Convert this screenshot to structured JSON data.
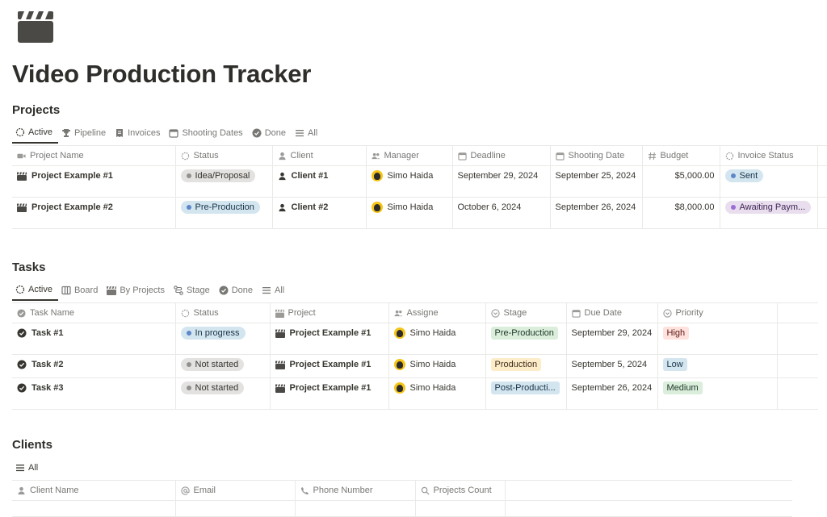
{
  "page": {
    "title": "Video Production Tracker",
    "icon": "clapperboard-icon"
  },
  "projects": {
    "title": "Projects",
    "views": [
      {
        "label": "Active",
        "icon": "loading-icon"
      },
      {
        "label": "Pipeline",
        "icon": "trophy-icon"
      },
      {
        "label": "Invoices",
        "icon": "receipt-icon"
      },
      {
        "label": "Shooting Dates",
        "icon": "calendar-icon"
      },
      {
        "label": "Done",
        "icon": "check-circle-icon"
      },
      {
        "label": "All",
        "icon": "list-icon"
      }
    ],
    "columns": [
      "Project Name",
      "Status",
      "Client",
      "Manager",
      "Deadline",
      "Shooting Date",
      "Budget",
      "Invoice Status"
    ],
    "rows": [
      {
        "name": "Project Example #1",
        "status": "Idea/Proposal",
        "client": "Client #1",
        "manager": "Simo Haida",
        "deadline": "September 29, 2024",
        "shooting": "September 25, 2024",
        "budget": "$5,000.00",
        "invoice": "Sent"
      },
      {
        "name": "Project Example #2",
        "status": "Pre-Production",
        "client": "Client #2",
        "manager": "Simo Haida",
        "deadline": "October 6, 2024",
        "shooting": "September 26, 2024",
        "budget": "$8,000.00",
        "invoice": "Awaiting Paym..."
      }
    ]
  },
  "tasks": {
    "title": "Tasks",
    "views": [
      {
        "label": "Active",
        "icon": "loading-icon"
      },
      {
        "label": "Board",
        "icon": "board-icon"
      },
      {
        "label": "By Projects",
        "icon": "clapperboard-icon"
      },
      {
        "label": "Stage",
        "icon": "flow-icon"
      },
      {
        "label": "Done",
        "icon": "check-circle-icon"
      },
      {
        "label": "All",
        "icon": "list-icon"
      }
    ],
    "columns": [
      "Task Name",
      "Status",
      "Project",
      "Assigne",
      "Stage",
      "Due Date",
      "Priority"
    ],
    "rows": [
      {
        "name": "Task #1",
        "status": "In progress",
        "project": "Project Example #1",
        "assignee": "Simo Haida",
        "stage": "Pre-Production",
        "due": "September 29, 2024",
        "priority": "High"
      },
      {
        "name": "Task #2",
        "status": "Not started",
        "project": "Project Example #1",
        "assignee": "Simo Haida",
        "stage": "Production",
        "due": "September 5, 2024",
        "priority": "Low"
      },
      {
        "name": "Task #3",
        "status": "Not started",
        "project": "Project Example #1",
        "assignee": "Simo Haida",
        "stage": "Post-Producti...",
        "due": "September 26, 2024",
        "priority": "Medium"
      }
    ]
  },
  "clients": {
    "title": "Clients",
    "views": [
      {
        "label": "All",
        "icon": "list-icon"
      }
    ],
    "columns": [
      "Client Name",
      "Email",
      "Phone Number",
      "Projects Count"
    ]
  }
}
